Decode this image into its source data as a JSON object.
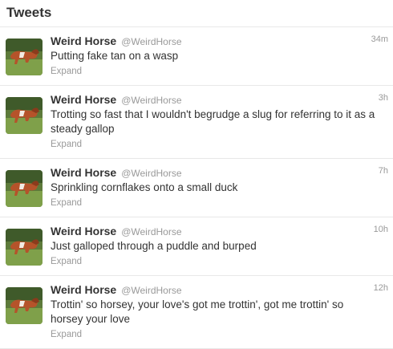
{
  "header": {
    "title": "Tweets"
  },
  "colors": {
    "text": "#333333",
    "muted": "#999999",
    "divider": "#e8e8e8"
  },
  "tweets": [
    {
      "fullname": "Weird Horse",
      "username": "@WeirdHorse",
      "time": "34m",
      "text": "Putting fake tan on a wasp",
      "expand": "Expand",
      "avatar_icon": "horse-avatar"
    },
    {
      "fullname": "Weird Horse",
      "username": "@WeirdHorse",
      "time": "3h",
      "text": "Trotting so fast that I wouldn't begrudge a slug for referring to it as a steady gallop",
      "expand": "Expand",
      "avatar_icon": "horse-avatar"
    },
    {
      "fullname": "Weird Horse",
      "username": "@WeirdHorse",
      "time": "7h",
      "text": "Sprinkling cornflakes onto a small duck",
      "expand": "Expand",
      "avatar_icon": "horse-avatar"
    },
    {
      "fullname": "Weird Horse",
      "username": "@WeirdHorse",
      "time": "10h",
      "text": "Just galloped through a puddle and burped",
      "expand": "Expand",
      "avatar_icon": "horse-avatar"
    },
    {
      "fullname": "Weird Horse",
      "username": "@WeirdHorse",
      "time": "12h",
      "text": "Trottin' so horsey, your love's got me trottin', got me trottin' so horsey your love",
      "expand": "Expand",
      "avatar_icon": "horse-avatar"
    }
  ]
}
